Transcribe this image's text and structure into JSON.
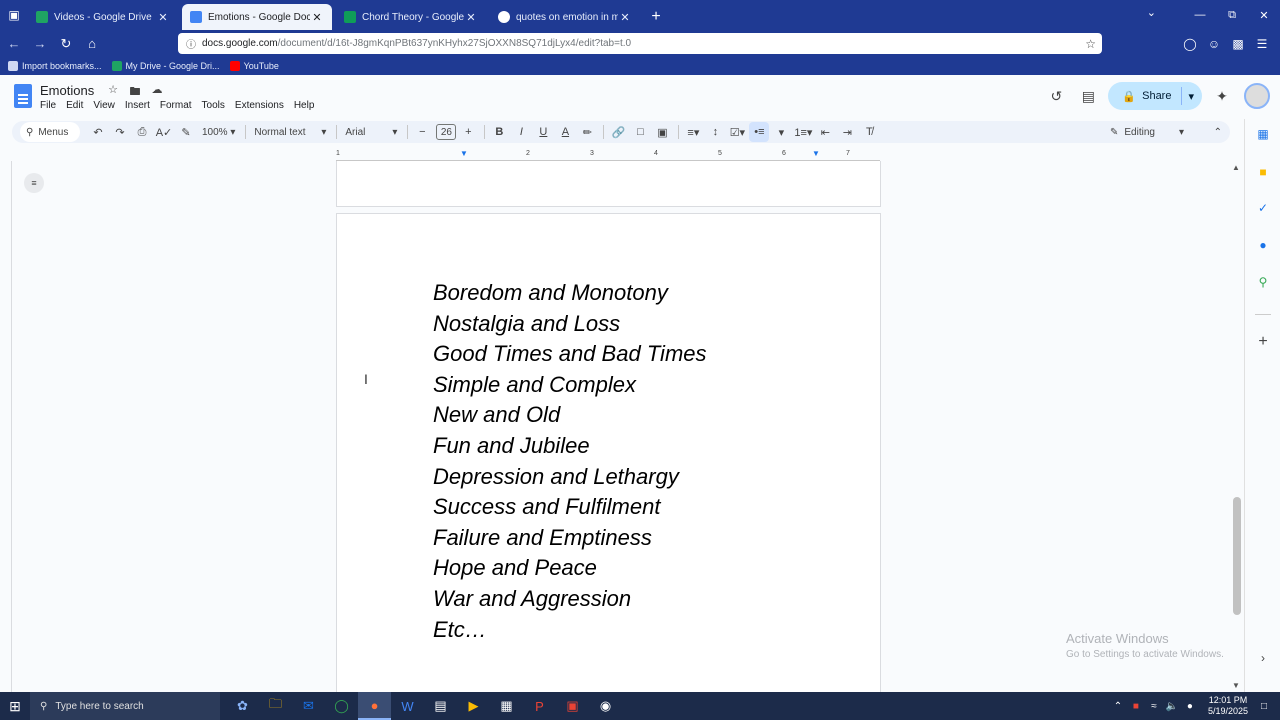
{
  "browser": {
    "tabs": [
      {
        "title": "Videos - Google Drive",
        "active": false,
        "icon": "drive-icon",
        "color": "#1fa463"
      },
      {
        "title": "Emotions - Google Docs",
        "active": true,
        "icon": "docs-icon",
        "color": "#4285f4"
      },
      {
        "title": "Chord Theory - Google Sheets",
        "active": false,
        "icon": "sheets-icon",
        "color": "#0f9d58"
      },
      {
        "title": "quotes on emotion in music - G",
        "active": false,
        "icon": "google-icon",
        "color": "#ffffff"
      }
    ],
    "url_host": "docs.google.com",
    "url_path": "/document/d/16t-J8gmKqnPBt637ynKHyhx27SjOXXN8SQ71djLyx4/edit?tab=t.0",
    "url_prefix": "docs.",
    "bookmarks": [
      {
        "label": "Import bookmarks...",
        "icon": "import-icon"
      },
      {
        "label": "My Drive - Google Dri...",
        "icon": "drive-icon"
      },
      {
        "label": "YouTube",
        "icon": "youtube-icon"
      }
    ]
  },
  "docs": {
    "title": "Emotions",
    "menu": [
      "File",
      "Edit",
      "View",
      "Insert",
      "Format",
      "Tools",
      "Extensions",
      "Help"
    ],
    "share_label": "Share",
    "toolbar": {
      "search_label": "Menus",
      "zoom": "100%",
      "style": "Normal text",
      "font": "Arial",
      "font_size": "26",
      "mode": "Editing"
    },
    "ruler_labels": [
      "1",
      "1",
      "2",
      "3",
      "4",
      "5",
      "6",
      "7"
    ],
    "lines": [
      "Boredom and Monotony",
      "Nostalgia and Loss",
      "Good Times and Bad Times",
      "Simple and Complex",
      "New and Old",
      "Fun and Jubilee",
      "Depression and Lethargy",
      "Success and Fulfilment",
      "Failure and Emptiness",
      "Hope and Peace",
      "War and Aggression",
      "Etc…"
    ]
  },
  "windows": {
    "activate_title": "Activate Windows",
    "activate_sub": "Go to Settings to activate Windows.",
    "search_placeholder": "Type here to search",
    "time": "12:01 PM",
    "date": "5/19/2025"
  }
}
